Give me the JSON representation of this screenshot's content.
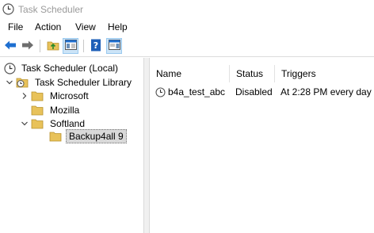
{
  "window": {
    "title": "Task Scheduler",
    "icon": "clock-icon"
  },
  "menu": {
    "file": "File",
    "action": "Action",
    "view": "View",
    "help": "Help"
  },
  "toolbar": {
    "buttons": [
      "back-arrow-icon",
      "forward-arrow-icon",
      "up-folder-icon",
      "show-hide-console-tree-icon",
      "help-icon",
      "show-hide-action-pane-icon"
    ]
  },
  "tree": {
    "root": "Task Scheduler (Local)",
    "library": "Task Scheduler Library",
    "microsoft": "Microsoft",
    "mozilla": "Mozilla",
    "softland": "Softland",
    "backup": "Backup4all 9"
  },
  "list": {
    "columns": {
      "name": "Name",
      "status": "Status",
      "triggers": "Triggers"
    },
    "rows": [
      {
        "name": "b4a_test_abc",
        "status": "Disabled",
        "triggers": "At 2:28 PM every day"
      }
    ]
  },
  "colors": {
    "folder": "#e8c25a",
    "accent_blue": "#1e6fd0",
    "selected_bg": "#d9d9d9",
    "pressed_bg": "#cce4f7"
  }
}
